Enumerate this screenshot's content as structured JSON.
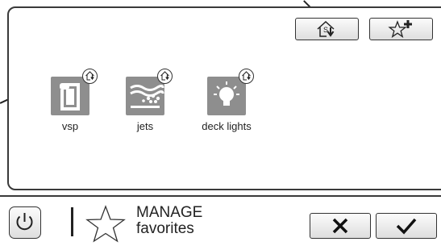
{
  "devices": [
    {
      "label": "vsp",
      "icon": "pump-icon"
    },
    {
      "label": "jets",
      "icon": "jets-icon"
    },
    {
      "label": "deck lights",
      "icon": "light-bulb-icon"
    }
  ],
  "manage": {
    "line1": "MANAGE",
    "line2": "favorites"
  },
  "toolbar": {
    "home_schedule": "home-schedule-icon",
    "add_favorite": "star-plus-icon"
  },
  "actions": {
    "cancel": "close-icon",
    "confirm": "check-icon"
  },
  "colors": {
    "tile": "#8e8e8e",
    "border": "#3a3a3a",
    "button_top": "#fbfbfb",
    "button_bottom": "#dedede"
  }
}
